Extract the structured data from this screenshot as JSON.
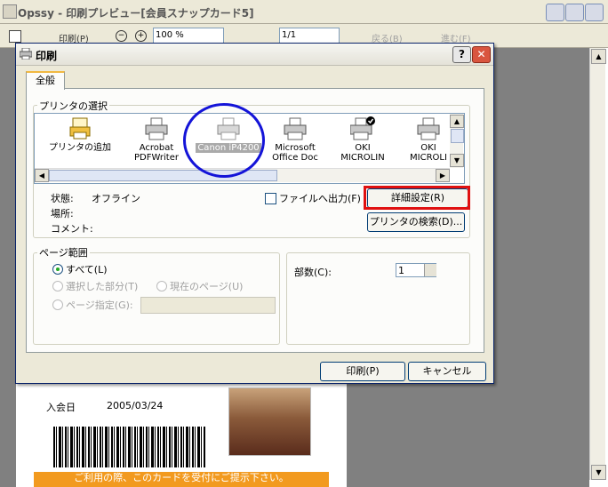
{
  "app": {
    "title": "Opssy - 印刷プレビュー[会員スナップカード5]",
    "toolbar": {
      "print_label": "印刷(P)",
      "zoom_value": "100 %",
      "page_value": "1/1",
      "back_label": "戻る(B)",
      "next_label": "進む(F)"
    }
  },
  "card": {
    "join_date_label": "入会日",
    "join_date_value": "2005/03/24",
    "footer_text": "ご利用の際、このカードを受付にご提示下さい。",
    "footer_color": "#f29a1f"
  },
  "dialog": {
    "title": "印刷",
    "help_label": "?",
    "close_label": "✕",
    "tab_general": "全般",
    "printer_section_label": "プリンタの選択",
    "printers": [
      {
        "name": "プリンタの追加",
        "icon": "add-printer-icon",
        "selected": false
      },
      {
        "name": "Acrobat\nPDFWriter",
        "icon": "printer-icon",
        "selected": false
      },
      {
        "name": "Canon iP4200",
        "icon": "printer-icon",
        "selected": true
      },
      {
        "name": "Microsoft\nOffice Doc",
        "icon": "printer-icon",
        "selected": false
      },
      {
        "name": "OKI\nMICROLIN",
        "icon": "default-printer-icon",
        "selected": false
      },
      {
        "name": "OKI\nMICROLI",
        "icon": "printer-icon",
        "selected": false
      }
    ],
    "status_label": "状態:",
    "status_value": "オフライン",
    "location_label": "場所:",
    "comment_label": "コメント:",
    "print_to_file_label": "ファイルへ出力(F)",
    "advanced_button": "詳細設定(R)",
    "find_printer_button": "プリンタの検索(D)...",
    "page_range_label": "ページ範囲",
    "range_all": "すべて(L)",
    "range_selection": "選択した部分(T)",
    "range_current": "現在のページ(U)",
    "range_pages": "ページ指定(G):",
    "copies_label": "部数(C):",
    "copies_value": "1",
    "print_button": "印刷(P)",
    "cancel_button": "キャンセル",
    "highlight_circle_color": "#1414d8",
    "highlight_box_color": "#e01010"
  }
}
